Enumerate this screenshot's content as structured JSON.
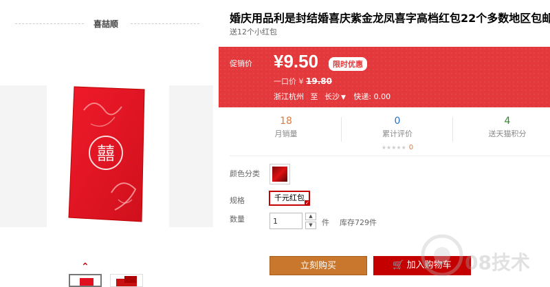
{
  "store": {
    "name": "喜喆顺"
  },
  "product": {
    "title": "婚庆用品利是封结婚喜庆紫金龙凤喜字高档红包22个多数地区包邮",
    "subtitle": "送12个小红包",
    "image_text": "囍"
  },
  "price": {
    "label": "促销价",
    "current": "¥9.50",
    "badge": "限时优惠",
    "orig_label": "一口价 ¥",
    "orig_value": "19.80",
    "ship_from": "浙江杭州",
    "ship_to_word": "至",
    "ship_dest": "长沙",
    "shipping": "快递: 0.00"
  },
  "stats": [
    {
      "value": "18",
      "label": "月销量"
    },
    {
      "value": "0",
      "label": "累计评价",
      "rating_count": "0"
    },
    {
      "value": "4",
      "label": "送天猫积分"
    }
  ],
  "options": {
    "color_label": "颜色分类",
    "spec_label": "规格",
    "spec_value": "千元红包",
    "qty_label": "数量",
    "qty_value": "1",
    "qty_unit": "件",
    "stock": "库存729件"
  },
  "buttons": {
    "buy": "立刻购买",
    "cart": "加入购物车"
  },
  "watermark": {
    "text": "08技术"
  },
  "colors": {
    "accent": "#e4393c",
    "buy": "#c9772d",
    "cart": "#c40000"
  }
}
